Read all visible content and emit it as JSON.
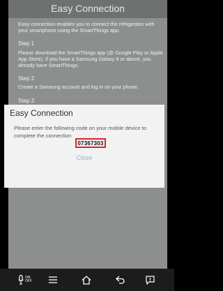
{
  "screen": {
    "title": "Easy Connection",
    "intro": "Easy connection enables you to connect the refrigerator with your smartphone using the SmartThings app.",
    "steps": [
      {
        "title": "Step 1",
        "text": "Please download the SmartThings app (@ Google Play or Apple App Store). If you have a Samsung Galaxy 8 or above, you already have SmartThings."
      },
      {
        "title": "Step 2",
        "text": "Create a Samsung account and log in on your phone."
      },
      {
        "title": "Step 3",
        "text": ""
      }
    ]
  },
  "dialog": {
    "title": "Easy Connection",
    "message": "Please enter the following code on your mobile device to complete the connection",
    "code": "07367303",
    "close_label": "Close"
  },
  "navbar": {
    "mic_label_top": "ON",
    "mic_label_bottom": "OFF",
    "icons": [
      "mic-onoff-icon",
      "menu-icon",
      "home-icon",
      "back-icon",
      "feedback-icon"
    ]
  }
}
